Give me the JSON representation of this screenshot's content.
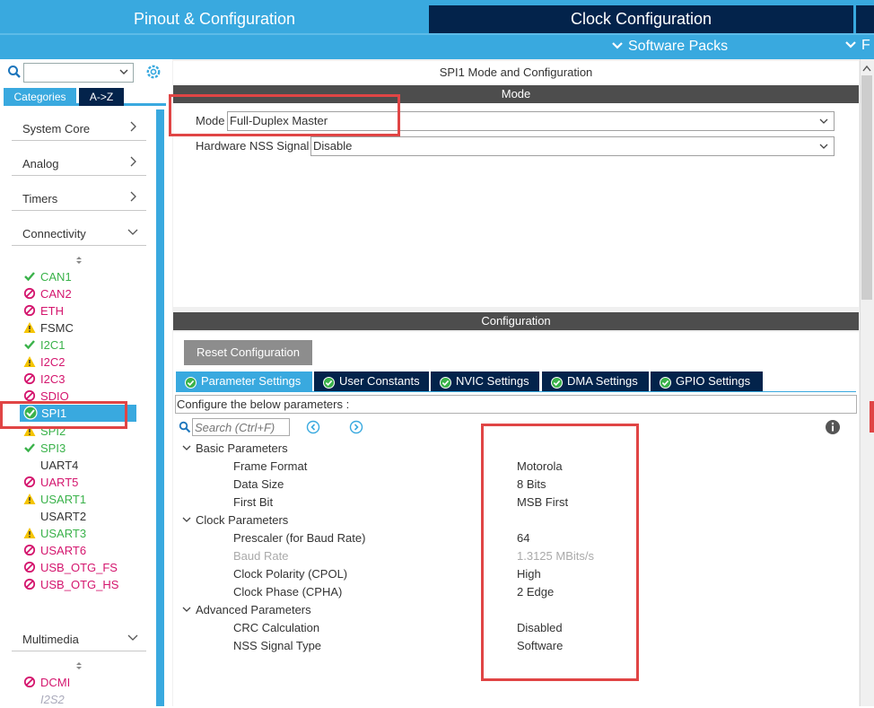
{
  "header": {
    "tab_pinout": "Pinout & Configuration",
    "tab_clock": "Clock Configuration",
    "software_packs": "Software Packs",
    "extra_tab_fragment": "F"
  },
  "left": {
    "search": {
      "value": "",
      "placeholder": ""
    },
    "tabs": {
      "categories": "Categories",
      "atoz": "A->Z"
    },
    "categories": [
      {
        "label": "System Core",
        "state": "collapsed"
      },
      {
        "label": "Analog",
        "state": "collapsed"
      },
      {
        "label": "Timers",
        "state": "collapsed"
      },
      {
        "label": "Connectivity",
        "state": "expanded"
      }
    ],
    "peripherals": [
      {
        "label": "CAN1",
        "status": "ok"
      },
      {
        "label": "CAN2",
        "status": "blocked"
      },
      {
        "label": "ETH",
        "status": "blocked"
      },
      {
        "label": "FSMC",
        "status": "warning"
      },
      {
        "label": "I2C1",
        "status": "ok"
      },
      {
        "label": "I2C2",
        "status": "warning"
      },
      {
        "label": "I2C3",
        "status": "blocked"
      },
      {
        "label": "SDIO",
        "status": "blocked"
      },
      {
        "label": "SPI1",
        "status": "selected"
      },
      {
        "label": "SPI2",
        "status": "warning"
      },
      {
        "label": "SPI3",
        "status": "ok"
      },
      {
        "label": "UART4",
        "status": "none"
      },
      {
        "label": "UART5",
        "status": "blocked"
      },
      {
        "label": "USART1",
        "status": "warning"
      },
      {
        "label": "USART2",
        "status": "none"
      },
      {
        "label": "USART3",
        "status": "warning"
      },
      {
        "label": "USART6",
        "status": "blocked"
      },
      {
        "label": "USB_OTG_FS",
        "status": "blocked"
      },
      {
        "label": "USB_OTG_HS",
        "status": "blocked"
      }
    ],
    "multimedia": {
      "label": "Multimedia",
      "state": "expanded"
    },
    "multimedia_items": [
      {
        "label": "DCMI",
        "status": "blocked"
      },
      {
        "label": "I2S2",
        "status": "disabled"
      }
    ]
  },
  "mode": {
    "title": "SPI1 Mode and Configuration",
    "header": "Mode",
    "fields": [
      {
        "label": "Mode",
        "value": "Full-Duplex Master"
      },
      {
        "label": "Hardware NSS Signal",
        "value": "Disable"
      }
    ]
  },
  "config": {
    "header": "Configuration",
    "reset_button": "Reset Configuration",
    "tabs": [
      "Parameter Settings",
      "User Constants",
      "NVIC Settings",
      "DMA Settings",
      "GPIO Settings"
    ],
    "active_tab": "Parameter Settings",
    "configure_text": "Configure the below parameters :",
    "search_placeholder": "Search (Ctrl+F)",
    "groups": [
      {
        "label": "Basic Parameters",
        "params": [
          {
            "name": "Frame Format",
            "value": "Motorola"
          },
          {
            "name": "Data Size",
            "value": "8 Bits"
          },
          {
            "name": "First Bit",
            "value": "MSB First"
          }
        ]
      },
      {
        "label": "Clock Parameters",
        "params": [
          {
            "name": "Prescaler (for Baud Rate)",
            "value": "64"
          },
          {
            "name": "Baud Rate",
            "value": "1.3125 MBits/s",
            "disabled": true
          },
          {
            "name": "Clock Polarity (CPOL)",
            "value": "High"
          },
          {
            "name": "Clock Phase (CPHA)",
            "value": "2 Edge"
          }
        ]
      },
      {
        "label": "Advanced Parameters",
        "params": [
          {
            "name": "CRC Calculation",
            "value": "Disabled"
          },
          {
            "name": "NSS Signal Type",
            "value": "Software"
          }
        ]
      }
    ]
  },
  "colors": {
    "accent_blue": "#39a9df",
    "dark_navy": "#03234b",
    "header_grey": "#4d4d4d",
    "ok_green": "#3ab24a",
    "blocked_pink": "#d4166e",
    "warning_yellow": "#f5c400",
    "annotation_red": "#e04545"
  }
}
